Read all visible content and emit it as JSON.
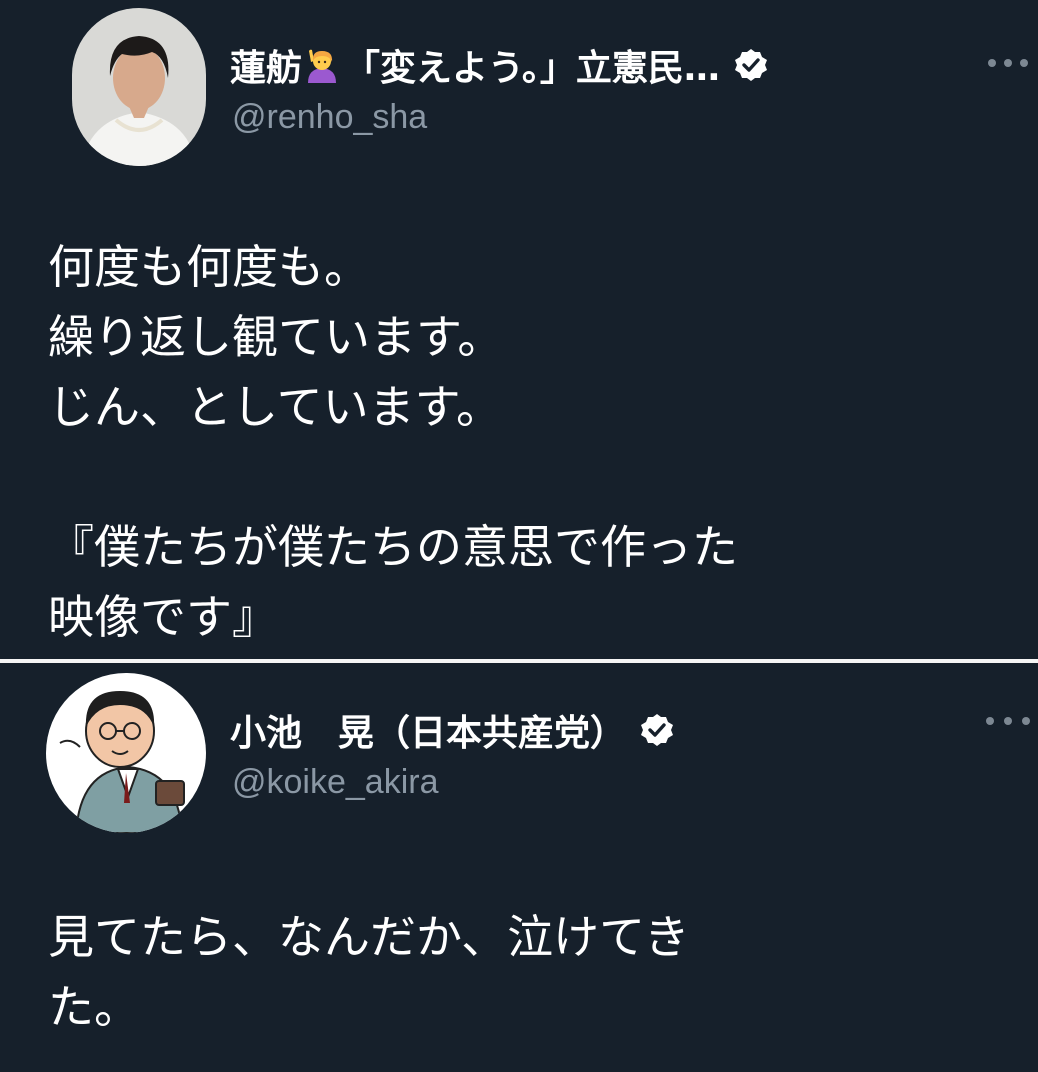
{
  "tweets": [
    {
      "display_name": "蓮舫",
      "name_suffix": "「変えよう。」立憲民…",
      "handle": "@renho_sha",
      "emoji": "person-raising-hand",
      "verified": true,
      "body_lines": [
        "何度も何度も。",
        "繰り返し観ています。",
        "じん、としています。"
      ],
      "quote_lines": [
        "『僕たちが僕たちの意思で作った",
        "映像です』"
      ]
    },
    {
      "display_name": "小池　晃（日本共産党）",
      "handle": "@koike_akira",
      "verified": true,
      "body_lines": [
        "見てたら、なんだか、泣けてき",
        "た。"
      ]
    }
  ],
  "colors": {
    "background": "#16202b",
    "text": "#ffffff",
    "secondary_text": "#8b98a5",
    "separator": "#f5f5f5"
  }
}
